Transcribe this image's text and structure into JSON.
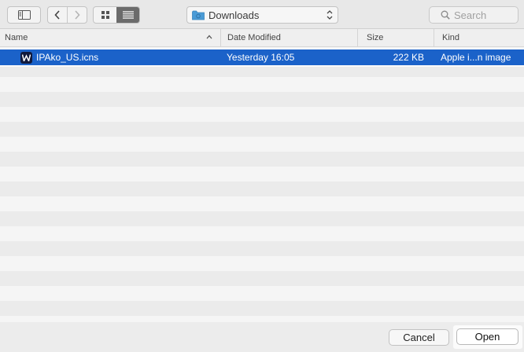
{
  "toolbar": {
    "location_label": "Downloads",
    "search_placeholder": "Search"
  },
  "columns": {
    "name": "Name",
    "date_modified": "Date Modified",
    "size": "Size",
    "kind": "Kind"
  },
  "files": [
    {
      "name": "IPAko_US.icns",
      "date_modified": "Yesterday 16:05",
      "size": "222 KB",
      "kind": "Apple i...n image",
      "selected": true
    }
  ],
  "buttons": {
    "cancel": "Cancel",
    "open": "Open"
  },
  "colors": {
    "selection": "#1b62c9",
    "folder_icon": "#4a9bd6"
  },
  "icons": {
    "sidebar": "sidebar-icon",
    "back": "chevron-left-icon",
    "forward": "chevron-right-icon",
    "grid_view": "grid-view-icon",
    "list_view": "list-view-icon",
    "folder": "folder-icon",
    "updown": "updown-chevron-icon",
    "search": "search-icon",
    "sort": "sort-ascending-icon",
    "file": "icns-file-icon"
  }
}
